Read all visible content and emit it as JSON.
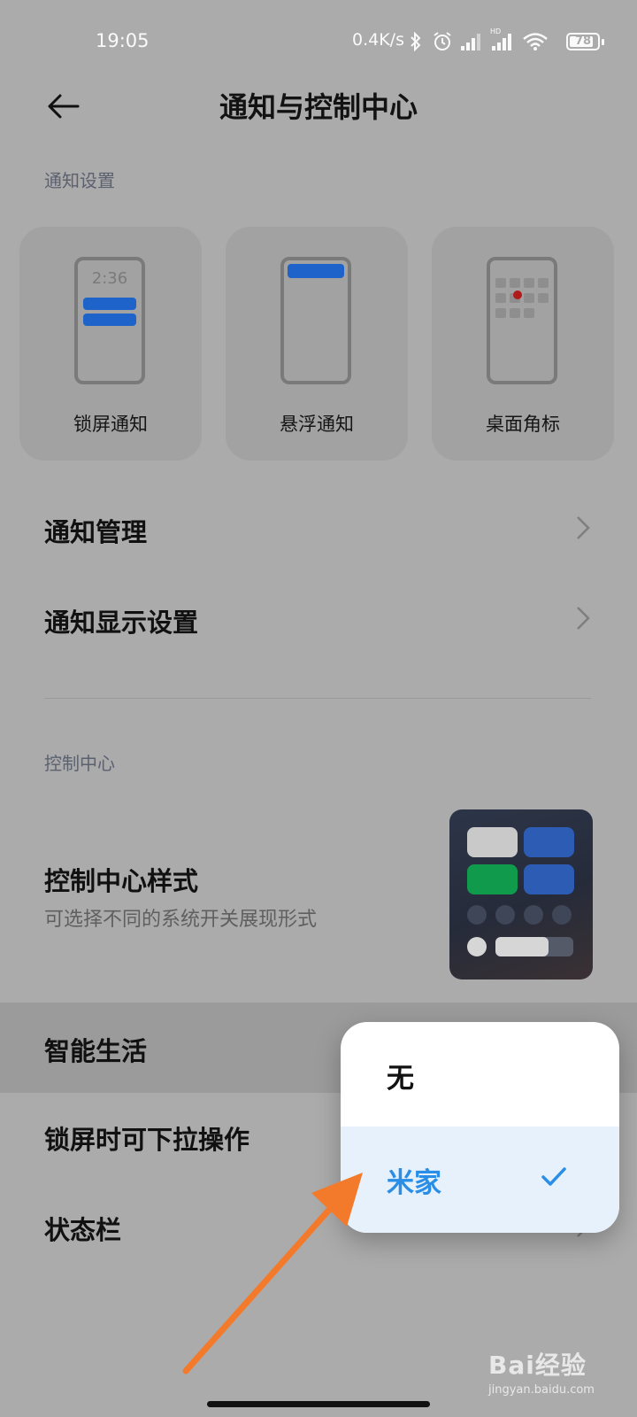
{
  "status_bar": {
    "time": "19:05",
    "net_speed": "0.4K/s",
    "battery": "78",
    "icons": [
      "bluetooth-icon",
      "alarm-icon",
      "signal-icon",
      "hd-signal-icon",
      "wifi-icon",
      "battery-icon"
    ]
  },
  "header": {
    "title": "通知与控制中心",
    "back_icon": "back-arrow-icon"
  },
  "notification_section": {
    "label": "通知设置",
    "cards": [
      {
        "label": "锁屏通知",
        "preview_time": "2:36"
      },
      {
        "label": "悬浮通知"
      },
      {
        "label": "桌面角标"
      }
    ]
  },
  "notification_rows": [
    {
      "label": "通知管理"
    },
    {
      "label": "通知显示设置"
    }
  ],
  "control_section": {
    "label": "控制中心",
    "style_title": "控制中心样式",
    "style_subtitle": "可选择不同的系统开关展现形式"
  },
  "settings_rows": [
    {
      "label": "智能生活",
      "highlighted": true
    },
    {
      "label": "锁屏时可下拉操作"
    },
    {
      "label": "状态栏"
    }
  ],
  "popup": {
    "options": [
      {
        "label": "无",
        "selected": false
      },
      {
        "label": "米家",
        "selected": true
      }
    ]
  },
  "watermark": {
    "brand": "Bai经验",
    "url": "jingyan.baidu.com"
  },
  "colors": {
    "background": "#ababab",
    "accent_blue": "#2b8ee6",
    "selected_bg": "#e6f1fc",
    "arrow": "#f47a2b"
  }
}
